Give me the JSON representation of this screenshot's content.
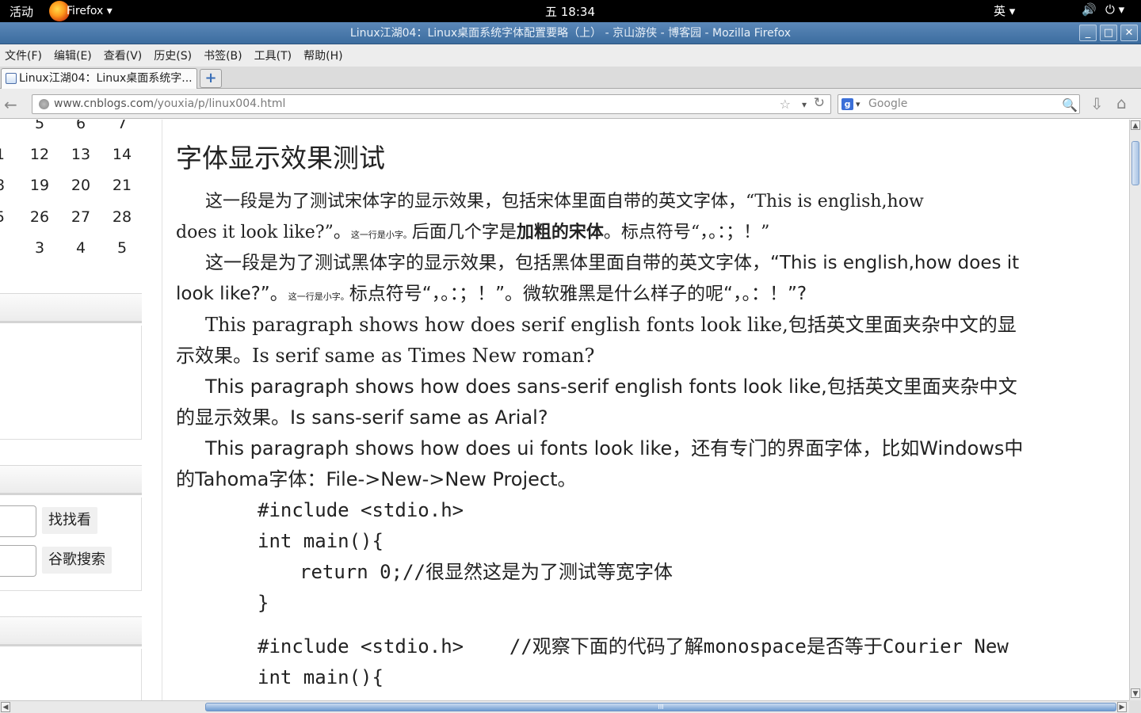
{
  "topbar": {
    "activities": "活动",
    "app_name": "Firefox ▾",
    "clock": "五 18:34",
    "ime": "英 ▾",
    "volume_icon": "🔊",
    "power_icon": "⏻ ▾"
  },
  "window": {
    "title": "Linux江湖04：Linux桌面系统字体配置要略（上） - 京山游侠 - 博客园 - Mozilla Firefox",
    "min": "_",
    "max": "□",
    "close": "✕"
  },
  "menu": [
    "文件(F)",
    "编辑(E)",
    "查看(V)",
    "历史(S)",
    "书签(B)",
    "工具(T)",
    "帮助(H)"
  ],
  "tab": {
    "title": "Linux江湖04：Linux桌面系统字...",
    "new": "+"
  },
  "nav": {
    "back": "←",
    "url_host": "www.cnblogs.com",
    "url_path": "/youxia/p/linux004.html",
    "star": "☆",
    "drop": "▾",
    "reload": "↻",
    "search_placeholder": "Google",
    "search_engine": "g",
    "search_drop": "▾",
    "mag": "🔍",
    "download": "⇩",
    "home": "⌂"
  },
  "sidebar": {
    "calendar": [
      [
        "",
        "5",
        "6",
        "7"
      ],
      [
        "1",
        "12",
        "13",
        "14"
      ],
      [
        "8",
        "19",
        "20",
        "21"
      ],
      [
        "5",
        "26",
        "27",
        "28"
      ],
      [
        "",
        "3",
        "4",
        "5"
      ]
    ],
    "search_btn": "找找看",
    "google_btn": "谷歌搜索"
  },
  "article": {
    "heading": "字体显示效果测试",
    "p1_a": "这一段是为了测试宋体字的显示效果，包括宋体里面自带的英文字体，“This is english,how",
    "p1_b": "does it look like?”。",
    "p1_small": "这一行是小字。",
    "p1_c": "后面几个字是",
    "p1_bold": "加粗的宋体",
    "p1_d": "。标点符号“，。：；！”",
    "p2_a": "这一段是为了测试黑体字的显示效果，包括黑体里面自带的英文字体，“This is english,how does it",
    "p2_b": "look like?”。",
    "p2_small": "这一行是小字。",
    "p2_c": "标点符号“，。：；！”。微软雅黑是什么样子的呢“，。：！”?",
    "p3_a": "This paragraph shows how does serif english fonts look like,包括英文里面夹杂中文的显",
    "p3_b": "示效果。Is serif same as Times New roman?",
    "p4_a": "This paragraph shows how does sans-serif english fonts look like,包括英文里面夹杂中文",
    "p4_b": "的显示效果。Is sans-serif same as Arial?",
    "p5_a": "This paragraph shows how does ui fonts look like，还有专门的界面字体，比如Windows中",
    "p5_b": "的Tahoma字体：File->New->New Project。",
    "code1": [
      "#include <stdio.h>",
      "int main(){",
      "return 0;//很显然这是为了测试等宽字体",
      "}"
    ],
    "code2_a": "#include <stdio.h>    //观察下面的代码了解monospace是否等于Courier New",
    "code2_b": "int main(){"
  },
  "scroll": {
    "up": "▲",
    "down": "▼",
    "left": "◀",
    "right": "▶",
    "grip": "III"
  }
}
